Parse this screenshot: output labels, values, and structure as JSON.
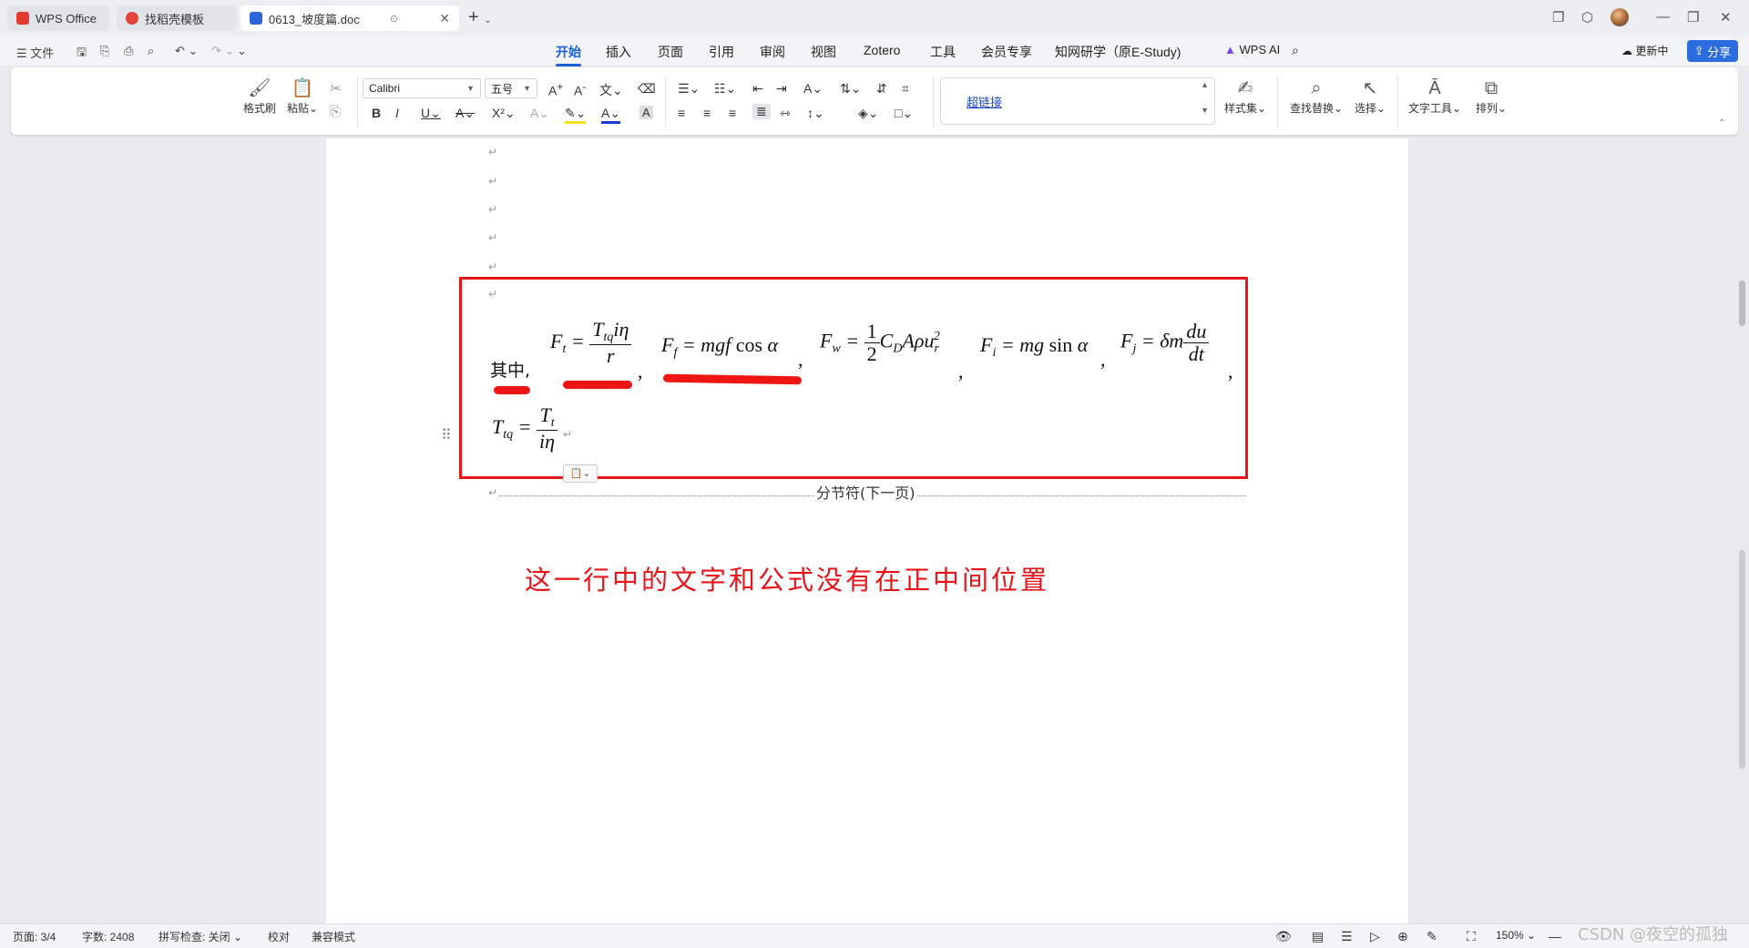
{
  "titlebar": {
    "tabs": [
      {
        "label": "WPS Office"
      },
      {
        "label": "找稻壳模板"
      },
      {
        "label": "0613_坡度篇.doc"
      }
    ]
  },
  "menubar": {
    "file": "文件",
    "items": [
      "开始",
      "插入",
      "页面",
      "引用",
      "审阅",
      "视图",
      "Zotero",
      "工具",
      "会员专享",
      "知网研学（原E-Study)"
    ],
    "active_index": 0,
    "wps_ai": "WPS AI",
    "update": "更新中",
    "share": "分享"
  },
  "ribbon": {
    "format_painter": "格式刷",
    "paste": "粘贴",
    "font_name": "Calibri",
    "font_size": "五号",
    "style_preview": "超链接",
    "style_set": "样式集",
    "find_replace": "查找替换",
    "select": "选择",
    "text_tools": "文字工具",
    "arrange": "排列"
  },
  "document": {
    "intro": "其中,",
    "comma": ",",
    "section_break": "分节符(下一页)",
    "annotation": "这一行中的文字和公式没有在正中间位置"
  },
  "statusbar": {
    "page": "页面: 3/4",
    "words": "字数: 2408",
    "spell": "拼写检查: 关闭",
    "proof": "校对",
    "compat": "兼容模式",
    "zoom": "150%"
  },
  "watermark": "CSDN @夜空的孤独",
  "colors": {
    "accent": "#1a5fd6",
    "annotation_red": "#e8141a"
  }
}
